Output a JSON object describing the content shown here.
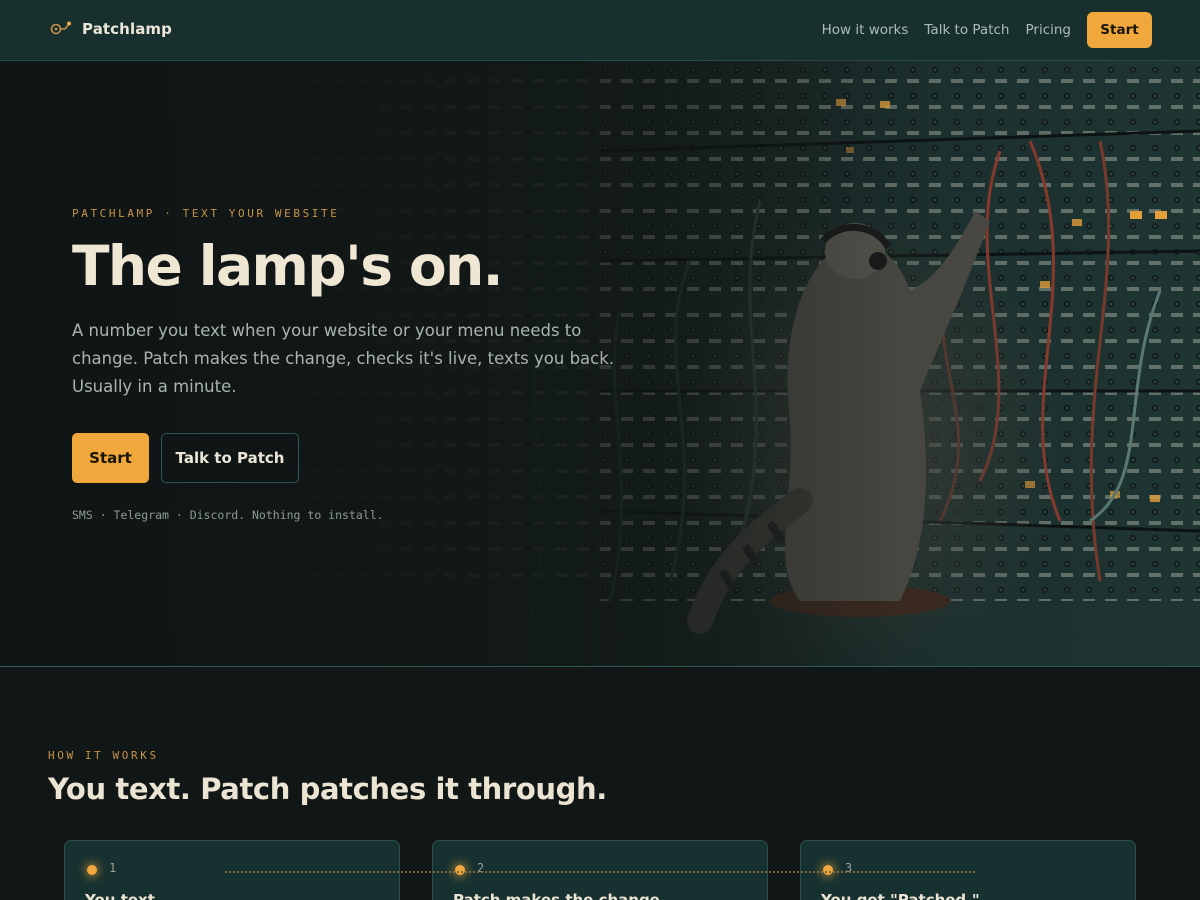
{
  "nav": {
    "brand": "Patchlamp",
    "links": [
      "How it works",
      "Talk to Patch",
      "Pricing"
    ],
    "cta": "Start"
  },
  "hero": {
    "eyebrow": "PATCHLAMP · TEXT YOUR WEBSITE",
    "title": "The lamp's on.",
    "subtitle": "A number you text when your website or your menu needs to change. Patch makes the change, checks it's live, texts you back. Usually in a minute.",
    "primary_cta": "Start",
    "secondary_cta": "Talk to Patch",
    "note": "SMS · Telegram · Discord. Nothing to install."
  },
  "how": {
    "eyebrow": "HOW IT WORKS",
    "title": "You text. Patch patches it through.",
    "steps": [
      {
        "num": "1",
        "title": "You text."
      },
      {
        "num": "2",
        "title": "Patch makes the change."
      },
      {
        "num": "3",
        "title": "You get \"Patched.\""
      }
    ]
  },
  "colors": {
    "accent": "#f0a73c",
    "nav_bg": "#17302e",
    "page_bg": "#111716",
    "card_bg": "#173130"
  },
  "icons": {
    "brand": "patch-lamp-icon",
    "step_marker": "lamp-dot-icon"
  }
}
